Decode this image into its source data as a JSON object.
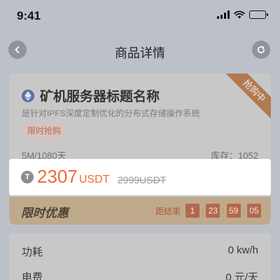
{
  "status_bar": {
    "time": "9:41",
    "icons": [
      "signal-icon",
      "wifi-icon",
      "battery-icon"
    ]
  },
  "nav": {
    "title": "商品详情",
    "back_icon": "chevron-left-icon",
    "refresh_icon": "refresh-icon"
  },
  "product": {
    "ribbon": "抢购中",
    "title": "矿机服务器标题名称",
    "description": "是针对IPFS深度定制优化的分布式存储操作系统",
    "tag": "限时抢购",
    "spec": "5M/1080天",
    "stock_label": "库存：",
    "stock_value": "1052",
    "price": "2307",
    "price_unit": "USDT",
    "original_price": "2999USDT",
    "promo_label": "限时优惠",
    "countdown_label": "距结束",
    "countdown": {
      "d": "1",
      "h": "23",
      "m": "59",
      "s": "05"
    }
  },
  "specs": [
    {
      "label": "功耗",
      "value": "0 kw/h"
    },
    {
      "label": "电费",
      "value": "0 元/天"
    }
  ],
  "colors": {
    "accent": "#ef6a3a",
    "ribbon": "#b07a52",
    "countdown_box": "#b3694b"
  }
}
